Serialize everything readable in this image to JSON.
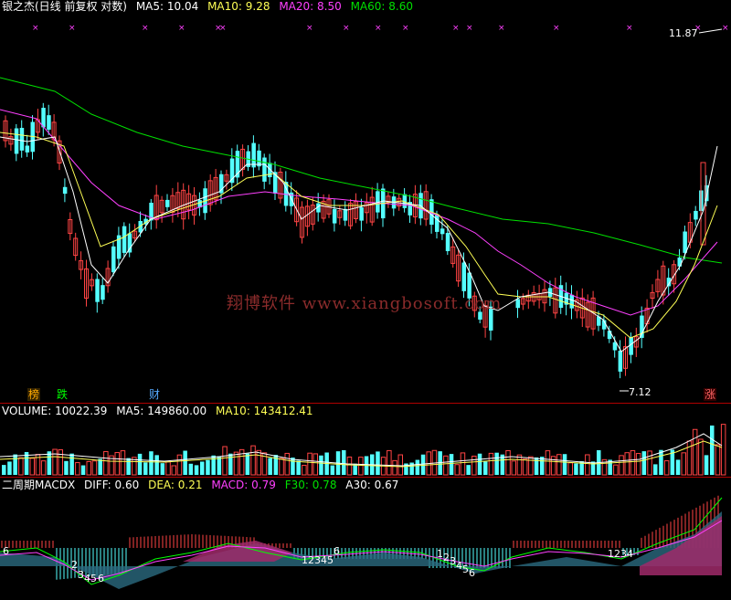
{
  "main_header": {
    "title": "银之杰(日线 前复权 对数)",
    "ma5": "MA5: 10.04",
    "ma10": "MA10: 9.28",
    "ma20": "MA20: 8.50",
    "ma60": "MA60: 8.60"
  },
  "price_labels": {
    "high": "11.87",
    "low": "7.12"
  },
  "markers": {
    "bang": "榜",
    "die": "跌",
    "cai": "财",
    "zhang": "涨"
  },
  "watermark": "翔博软件 www.xiangbosoft.com",
  "volume_header": {
    "volume": "VOLUME: 10022.39",
    "ma5": "MA5: 149860.00",
    "ma10": "MA10: 143412.41"
  },
  "macd_header": {
    "name": "二周期MACDX",
    "diff": "DIFF: 0.60",
    "dea": "DEA: 0.21",
    "macd": "MACD: 0.79",
    "f30": "F30: 0.78",
    "a30": "A30: 0.67"
  },
  "macd_digits": [
    "6",
    "2",
    "3",
    "4",
    "5",
    "6",
    "1",
    "2",
    "3",
    "4",
    "5",
    "6",
    "1",
    "2",
    "3",
    "4",
    "5",
    "6",
    "1",
    "2",
    "3",
    "4"
  ],
  "colors": {
    "up": "#ff4444",
    "down": "#54ffff",
    "ma5": "#ffffff",
    "ma10": "#ffff55",
    "ma20": "#ff40ff",
    "ma60": "#00e000",
    "grid": "#b00000"
  },
  "chart_data": {
    "type": "candlestick",
    "price_range": [
      7.12,
      11.87
    ],
    "series": [
      {
        "name": "MA5",
        "value": 10.04
      },
      {
        "name": "MA10",
        "value": 9.28
      },
      {
        "name": "MA20",
        "value": 8.5
      },
      {
        "name": "MA60",
        "value": 8.6
      }
    ],
    "volume_series": [
      {
        "name": "VOLUME",
        "value": 10022.39
      },
      {
        "name": "MA5",
        "value": 149860.0
      },
      {
        "name": "MA10",
        "value": 143412.41
      }
    ],
    "macd": {
      "DIFF": 0.6,
      "DEA": 0.21,
      "MACD": 0.79,
      "F30": 0.78,
      "A30": 0.67
    }
  }
}
